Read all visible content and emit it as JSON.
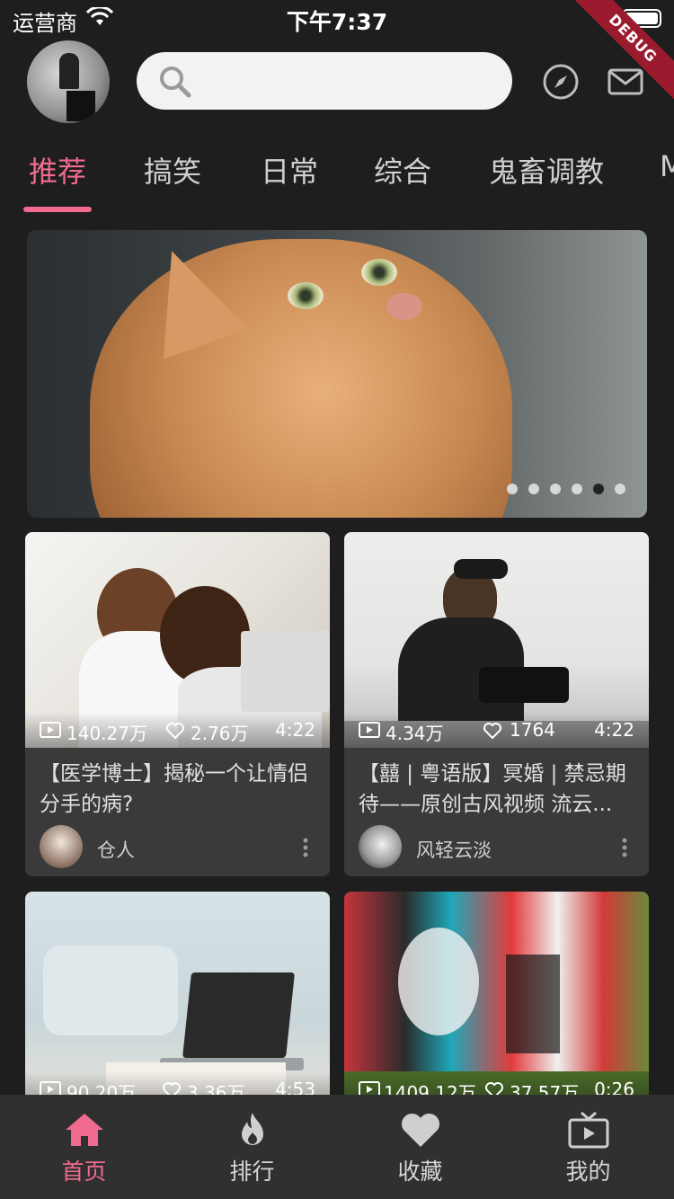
{
  "status_bar": {
    "carrier": "运营商",
    "time": "下午7:37"
  },
  "debug_banner": "DEBUG",
  "header": {
    "search_placeholder": ""
  },
  "tabs": [
    {
      "label": "推荐",
      "active": true
    },
    {
      "label": "搞笑",
      "active": false
    },
    {
      "label": "日常",
      "active": false
    },
    {
      "label": "综合",
      "active": false
    },
    {
      "label": "鬼畜调教",
      "active": false
    },
    {
      "label": "M",
      "active": false
    }
  ],
  "banner": {
    "page_count": 6,
    "active_index": 4
  },
  "cards": [
    {
      "views": "140.27万",
      "likes": "2.76万",
      "duration": "4:22",
      "title": "【医学博士】揭秘一个让情侣分手的病?",
      "author": "仓人"
    },
    {
      "views": "4.34万",
      "likes": "1764",
      "duration": "4:22",
      "title": "【囍 | 粤语版】冥婚 | 禁忌期待——原创古风视频 流云...",
      "author": "风轻云淡"
    },
    {
      "views": "90.20万",
      "likes": "3.36万",
      "duration": "4:53"
    },
    {
      "views": "1409.12万",
      "likes": "37.57万",
      "duration": "0:26"
    }
  ],
  "bottom_nav": [
    {
      "label": "首页",
      "icon": "home-icon",
      "active": true
    },
    {
      "label": "排行",
      "icon": "flame-icon",
      "active": false
    },
    {
      "label": "收藏",
      "icon": "heart-icon",
      "active": false
    },
    {
      "label": "我的",
      "icon": "tv-icon",
      "active": false
    }
  ],
  "colors": {
    "accent": "#f06b8f",
    "background": "#1e1e1e",
    "card": "#3a3a3a",
    "nav": "#303030"
  }
}
